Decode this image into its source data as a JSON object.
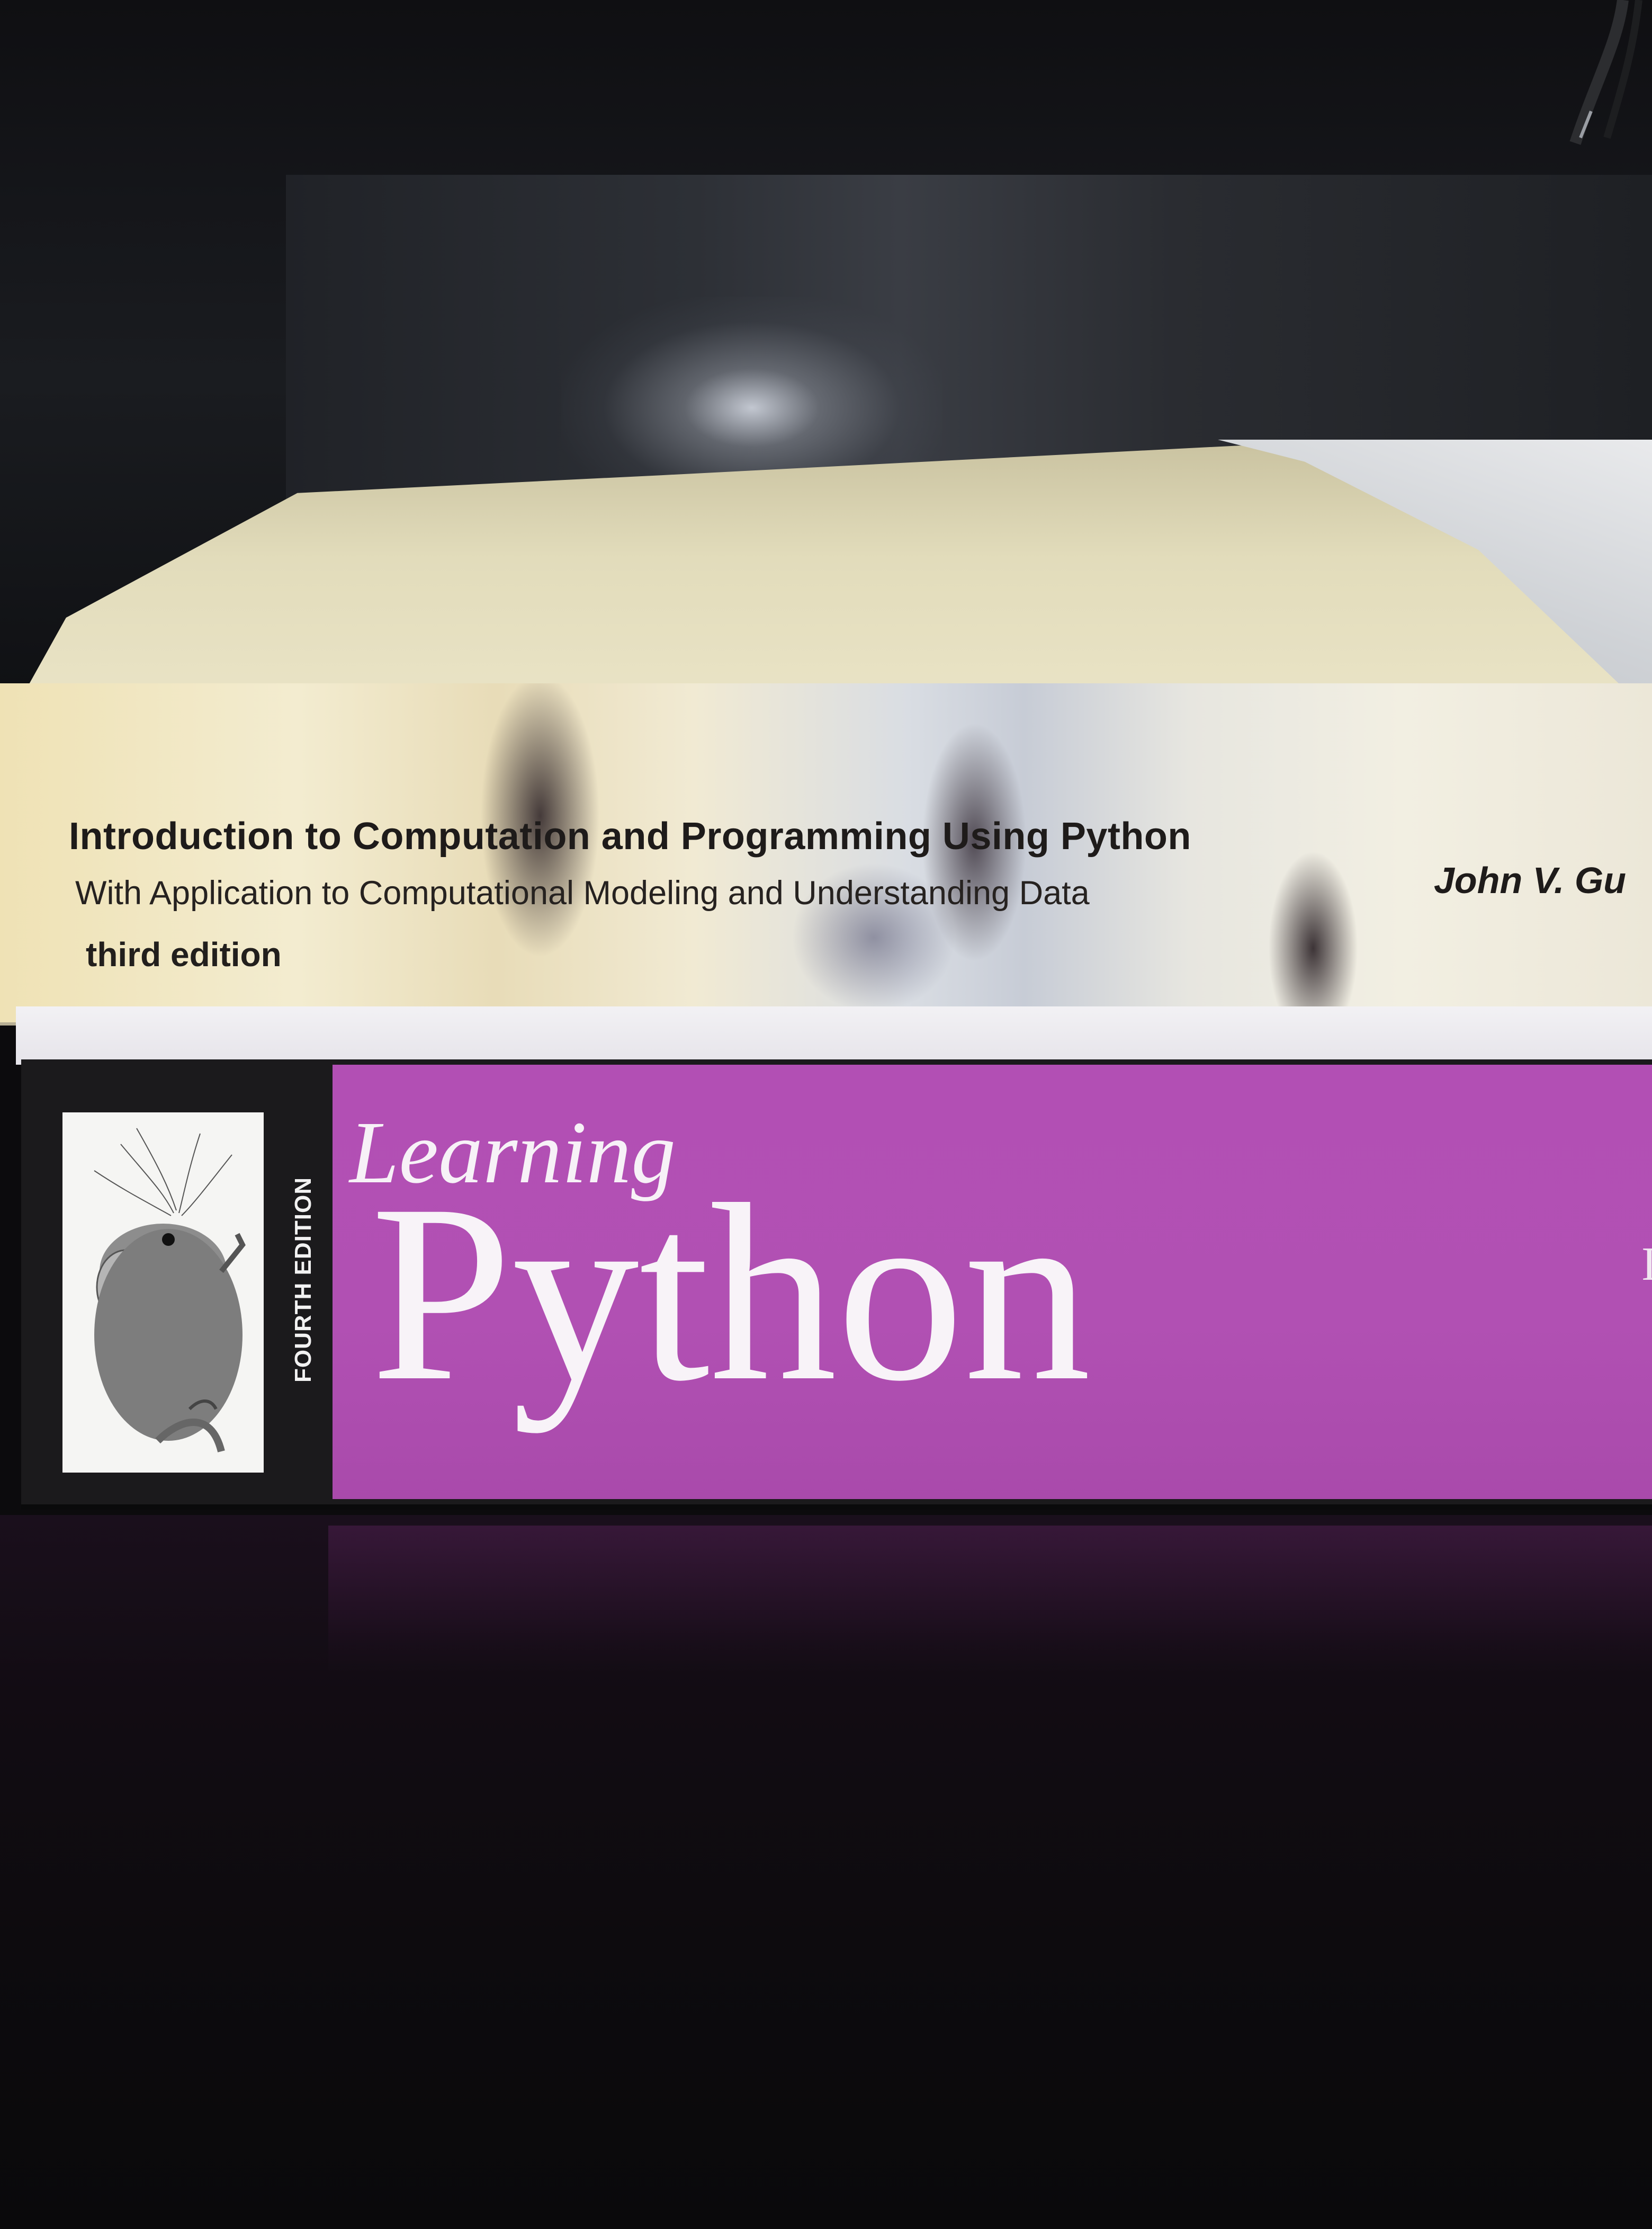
{
  "scene": {
    "book_top": {
      "title": "Introduction to Computation and Programming Using Python",
      "subtitle": "With Application to Computational Modeling and Understanding Data",
      "edition": "third edition",
      "author_visible": "John V. Gu"
    },
    "book_bottom": {
      "edition_label": "FOURTH EDITION",
      "title_line1": "Learning",
      "title_line2": "Python",
      "edge_glyph": "I",
      "accent_color": "#b150b3",
      "animal_illustration": "rat-illustration"
    }
  }
}
